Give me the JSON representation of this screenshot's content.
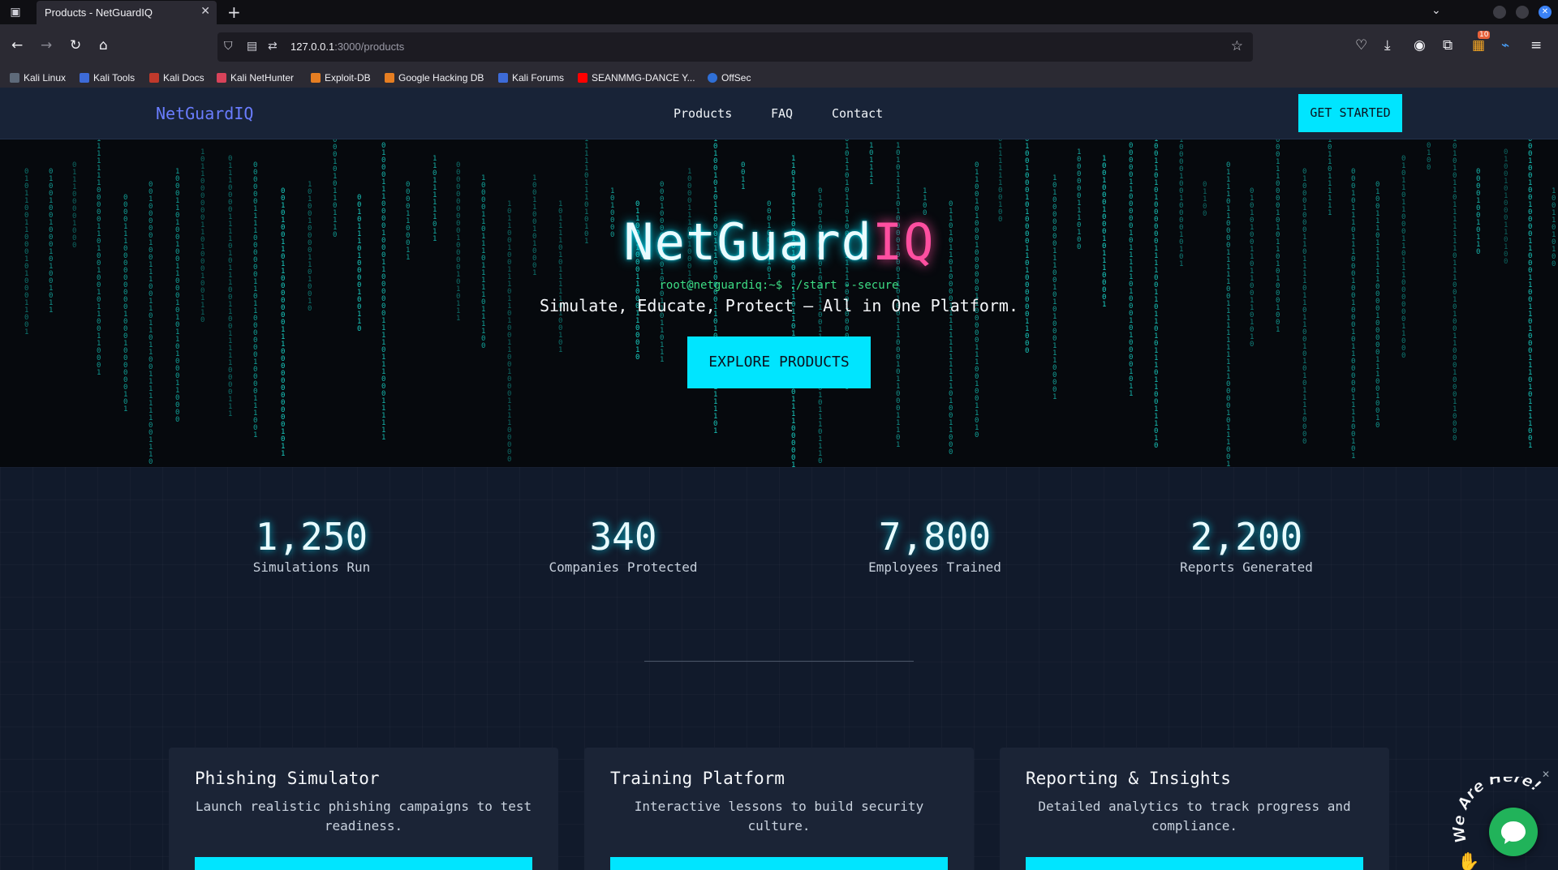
{
  "browser": {
    "tab_title": "Products - NetGuardIQ",
    "tab_close": "✕",
    "new_tab": "+",
    "url_host": "127.0.0.1",
    "url_path": ":3000/products",
    "bookmarks": [
      "Kali Linux",
      "Kali Tools",
      "Kali Docs",
      "Kali NetHunter",
      "Exploit-DB",
      "Google Hacking DB",
      "Kali Forums",
      "SEANMMG-DANCE Y...",
      "OffSec"
    ],
    "extension_badge": "10"
  },
  "site": {
    "logo": "NetGuardIQ",
    "nav": [
      "Products",
      "FAQ",
      "Contact"
    ],
    "cta": "GET STARTED",
    "colors": {
      "accent": "#00e5ff",
      "pink": "#ff4fa0",
      "terminal_green": "#3ddc84",
      "logo_blue": "#6a7dff"
    }
  },
  "hero": {
    "title_main": "NetGuard",
    "title_accent": "IQ",
    "terminal": "root@netguardiq:~$ ./start --secure",
    "tagline": "Simulate, Educate, Protect — All in One Platform.",
    "button": "EXPLORE PRODUCTS"
  },
  "stats": [
    {
      "value": "1,250",
      "label": "Simulations Run"
    },
    {
      "value": "340",
      "label": "Companies Protected"
    },
    {
      "value": "7,800",
      "label": "Employees Trained"
    },
    {
      "value": "2,200",
      "label": "Reports Generated"
    }
  ],
  "cards": [
    {
      "title": "Phishing Simulator",
      "desc": "Launch realistic phishing campaigns to test readiness."
    },
    {
      "title": "Training Platform",
      "desc": "Interactive lessons to build security culture."
    },
    {
      "title": "Reporting & Insights",
      "desc": "Detailed analytics to track progress and compliance."
    }
  ],
  "chat": {
    "badge_text": "We Are Here!"
  }
}
